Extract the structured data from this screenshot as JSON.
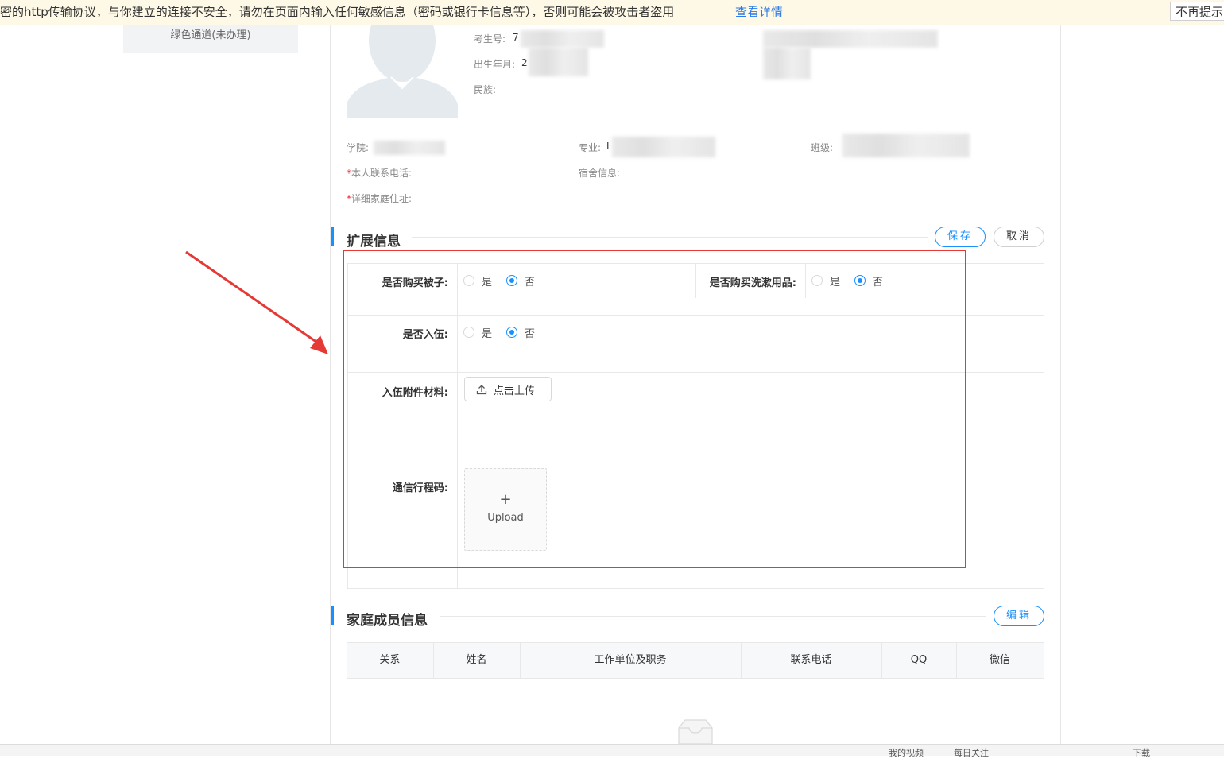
{
  "browser_warning": {
    "text": "密的http传输协议，与你建立的连接不安全，请勿在页面内输入任何敏感信息（密码或银行卡信息等），否则可能会被攻击者盗用",
    "link": "查看详情",
    "dismiss": "不再提示"
  },
  "sidebar": {
    "item": "绿色通道(未办理)"
  },
  "profile": {
    "exam_no_label": "考生号:",
    "exam_no_value": "7",
    "birth_label": "出生年月:",
    "birth_value": "2",
    "ethnicity_label": "民族:",
    "college_label": "学院:",
    "major_label": "专业:",
    "major_value": "I",
    "class_label": "班级:",
    "phone_label": "本人联系电话:",
    "dorm_label": "宿舍信息:",
    "address_label": "详细家庭住址:",
    "required_mark": "*"
  },
  "extended": {
    "title": "扩展信息",
    "save": "保存",
    "cancel": "取消",
    "quilt_label": "是否购买被子:",
    "toiletries_label": "是否购买洗漱用品:",
    "enlist_label": "是否入伍:",
    "enlist_material_label": "入伍附件材料:",
    "travel_code_label": "通信行程码:",
    "yes": "是",
    "no": "否",
    "upload_button": "点击上传",
    "upload_card": "Upload",
    "upload_plus": "+"
  },
  "family": {
    "title": "家庭成员信息",
    "edit": "编辑",
    "columns": [
      "关系",
      "姓名",
      "工作单位及职务",
      "联系电话",
      "QQ",
      "微信"
    ]
  },
  "status_bar": {
    "items": [
      "我的视频",
      "每日关注",
      "下载"
    ]
  }
}
